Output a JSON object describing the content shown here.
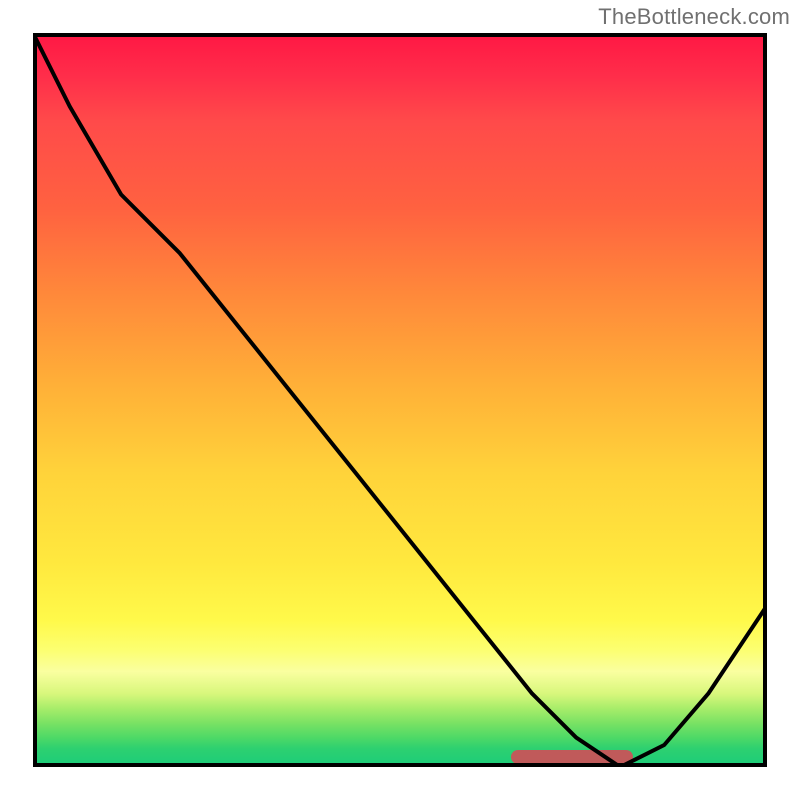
{
  "watermark": "TheBottleneck.com",
  "chart_data": {
    "type": "line",
    "x": [
      0.0,
      0.05,
      0.12,
      0.2,
      0.28,
      0.36,
      0.44,
      0.52,
      0.6,
      0.68,
      0.74,
      0.8,
      0.86,
      0.92,
      1.0
    ],
    "values": [
      1.0,
      0.9,
      0.78,
      0.7,
      0.6,
      0.5,
      0.4,
      0.3,
      0.2,
      0.1,
      0.04,
      0.0,
      0.03,
      0.1,
      0.22
    ],
    "marker_range_x": [
      0.69,
      0.82
    ],
    "marker_y": 0.015,
    "xlabel": "",
    "ylabel": "",
    "ylim": [
      0,
      1
    ],
    "xlim": [
      0,
      1
    ],
    "background_gradient": [
      "#ff1744",
      "#1bcd7a"
    ],
    "title": ""
  }
}
